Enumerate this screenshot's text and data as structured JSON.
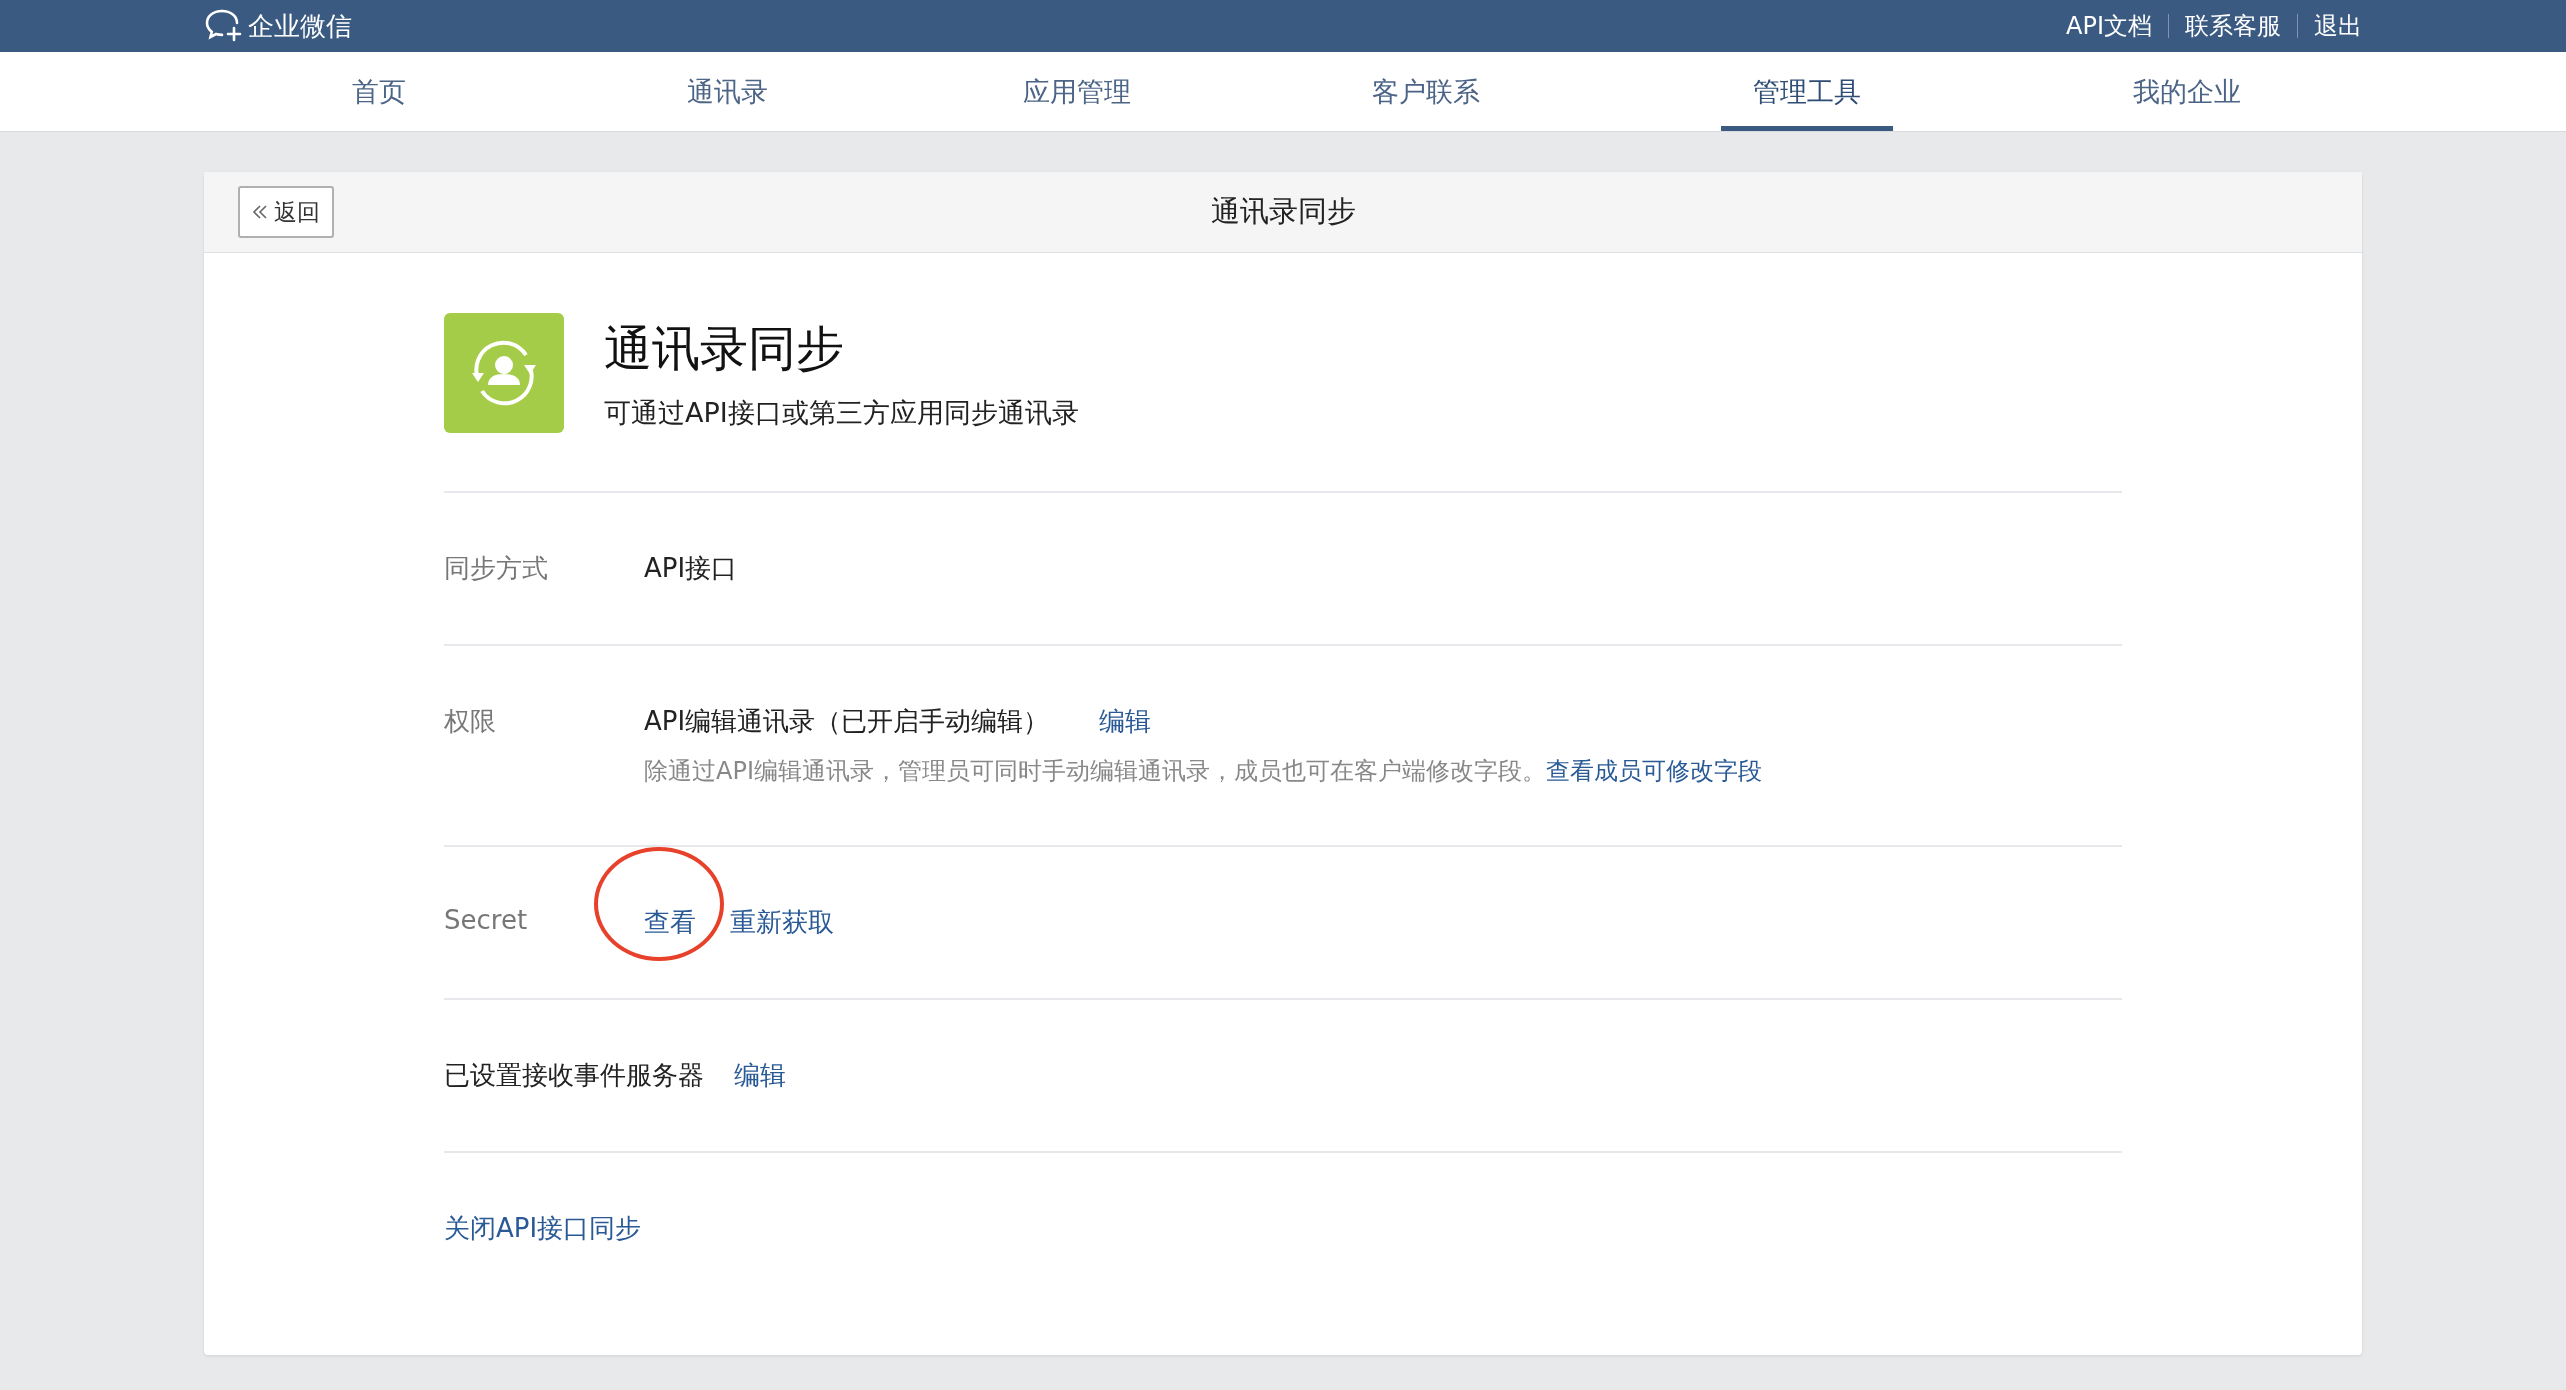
{
  "top_bar": {
    "logo_text": "企业微信",
    "links": [
      "API文档",
      "联系客服",
      "退出"
    ]
  },
  "tabs": [
    {
      "label": "首页",
      "selected": false
    },
    {
      "label": "通讯录",
      "selected": false
    },
    {
      "label": "应用管理",
      "selected": false
    },
    {
      "label": "客户联系",
      "selected": false
    },
    {
      "label": "管理工具",
      "selected": true
    },
    {
      "label": "我的企业",
      "selected": false
    }
  ],
  "card": {
    "back_button": "返回",
    "title": "通讯录同步",
    "app": {
      "name": "通讯录同步",
      "description": "可通过API接口或第三方应用同步通讯录"
    },
    "rows": [
      {
        "kind": "plain",
        "label": "同步方式",
        "value": "API接口"
      },
      {
        "kind": "permission",
        "label": "权限",
        "value": "API编辑通讯录（已开启手动编辑）",
        "link": "编辑",
        "note": "除通过API编辑通讯录，管理员可同时手动编辑通讯录，成员也可在客户端修改字段。",
        "note_link": "查看成员可修改字段"
      },
      {
        "kind": "links",
        "label": "Secret",
        "links": [
          {
            "label": "查看",
            "circled": true
          },
          {
            "label": "重新获取",
            "circled": false
          }
        ]
      },
      {
        "kind": "inline",
        "value": "已设置接收事件服务器",
        "link": "编辑"
      },
      {
        "kind": "action",
        "link": "关闭API接口同步"
      }
    ]
  }
}
